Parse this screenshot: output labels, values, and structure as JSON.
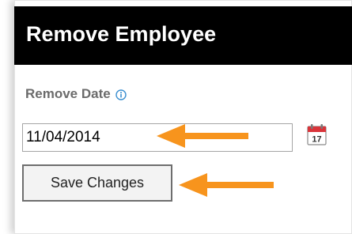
{
  "dialog": {
    "title": "Remove Employee"
  },
  "form": {
    "remove_date_label": "Remove Date",
    "remove_date_value": "11/04/2014",
    "info_icon": "info-icon",
    "calendar_icon": "calendar-icon",
    "calendar_day": "17",
    "save_label": "Save Changes"
  },
  "annotations": {
    "arrow_color": "#f7941d"
  },
  "colors": {
    "title_bar": "#000000",
    "title_text": "#ffffff",
    "label_text": "#6b6b6b",
    "info_icon": "#3b8fd0",
    "calendar_red": "#d9343a"
  }
}
